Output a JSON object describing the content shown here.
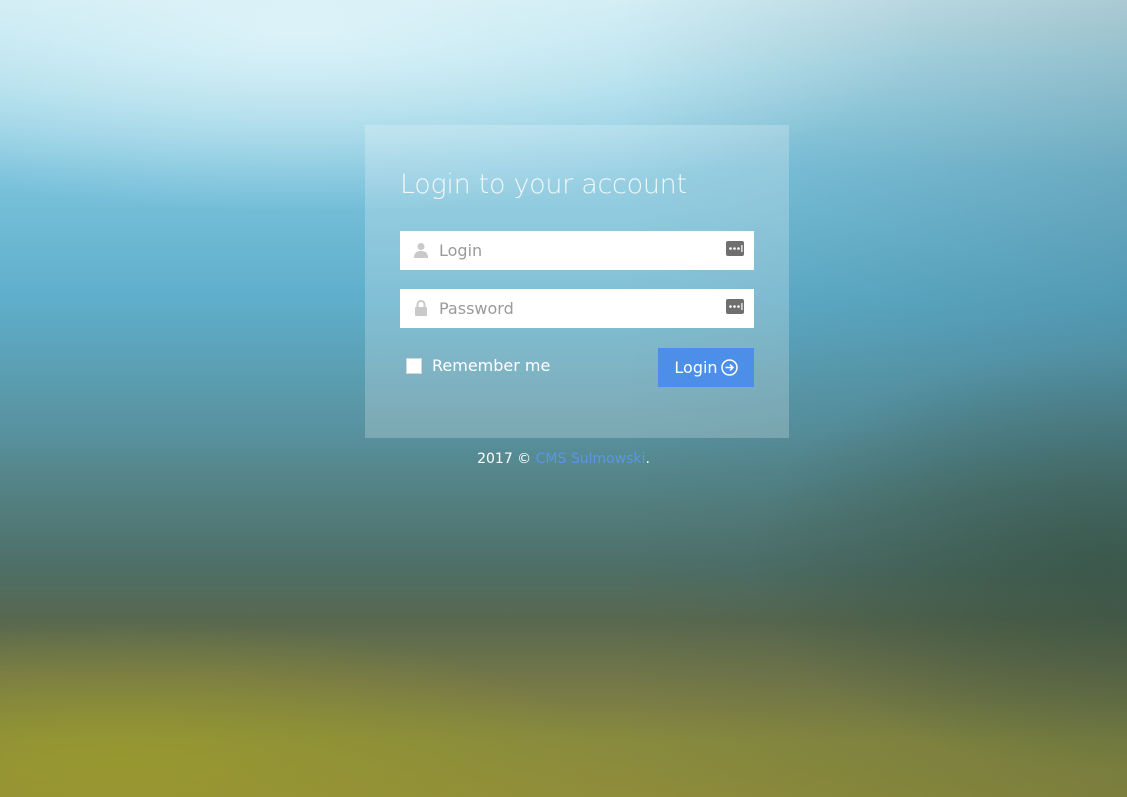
{
  "login_form": {
    "title": "Login to your account",
    "login_field": {
      "placeholder": "Login",
      "value": ""
    },
    "password_field": {
      "placeholder": "Password",
      "value": ""
    },
    "remember_label": "Remember me",
    "remember_checked": false,
    "submit_label": "Login"
  },
  "footer": {
    "year_text": "2017 ©",
    "link_text": "CMS Sulmowski",
    "suffix": "."
  },
  "icons": {
    "login_field": "user-icon",
    "password_field": "lock-icon",
    "credential_helper": "password-manager-key-icon",
    "submit": "circle-arrow-right-icon"
  },
  "colors": {
    "accent": "#4d8fe8",
    "link": "#5a95e6",
    "panel_overlay": "rgba(255,255,255,0.22)"
  }
}
